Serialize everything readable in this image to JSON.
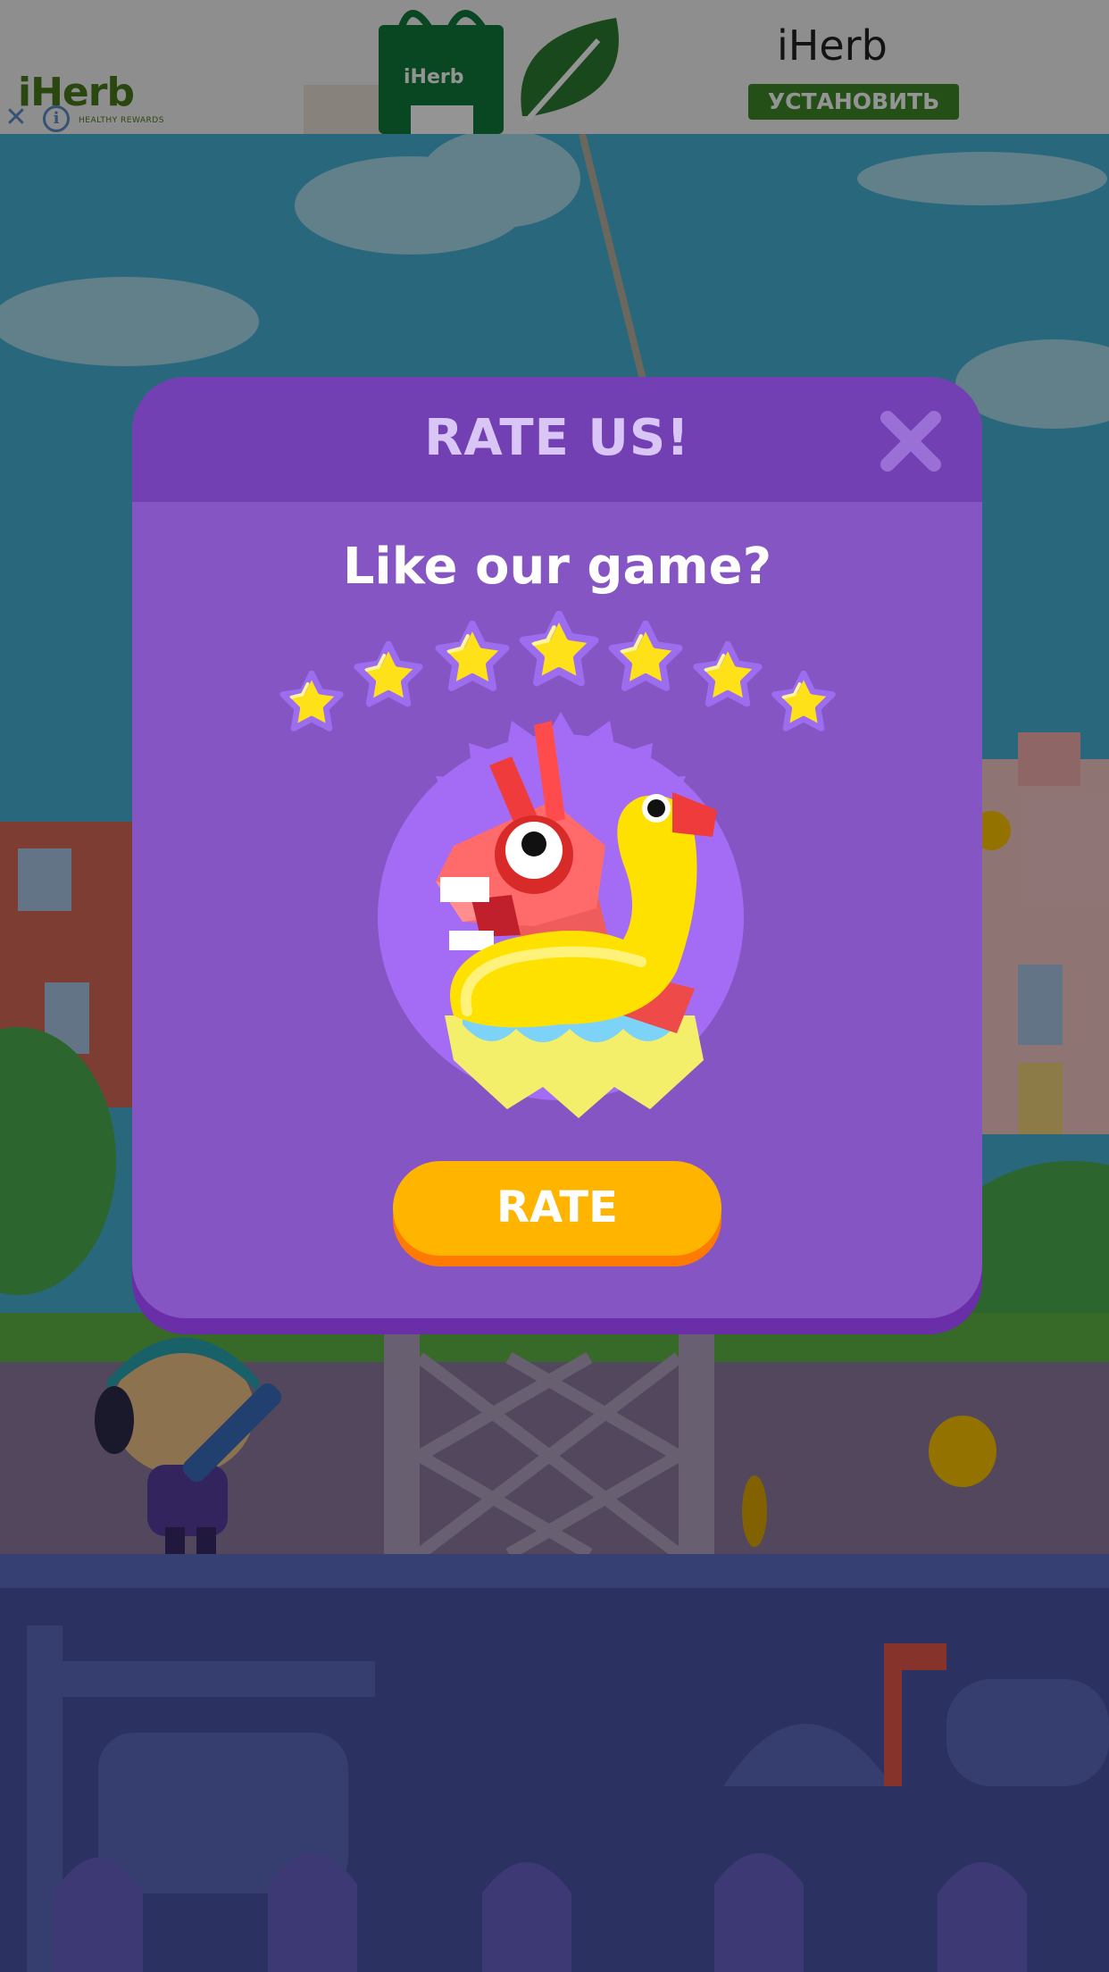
{
  "ad": {
    "brand_logo": "iHerb",
    "brand_tagline": "HEALTHY REWARDS",
    "bag_text": "iHerb",
    "title": "iHerb",
    "install_label": "УСТАНОВИТЬ",
    "close_glyph": "✕",
    "info_glyph": "i"
  },
  "dialog": {
    "title": "RATE US!",
    "subtitle": "Like our game?",
    "star_count": 7,
    "rate_label": "RATE"
  },
  "colors": {
    "dialog_body": "#8556c3",
    "dialog_header": "#7340b4",
    "title_text": "#d9c6f6",
    "rate_button": "#ffb400",
    "star": "#ffe11a"
  },
  "icons": {
    "close": "close-icon",
    "star": "star-icon",
    "info": "info-icon"
  }
}
